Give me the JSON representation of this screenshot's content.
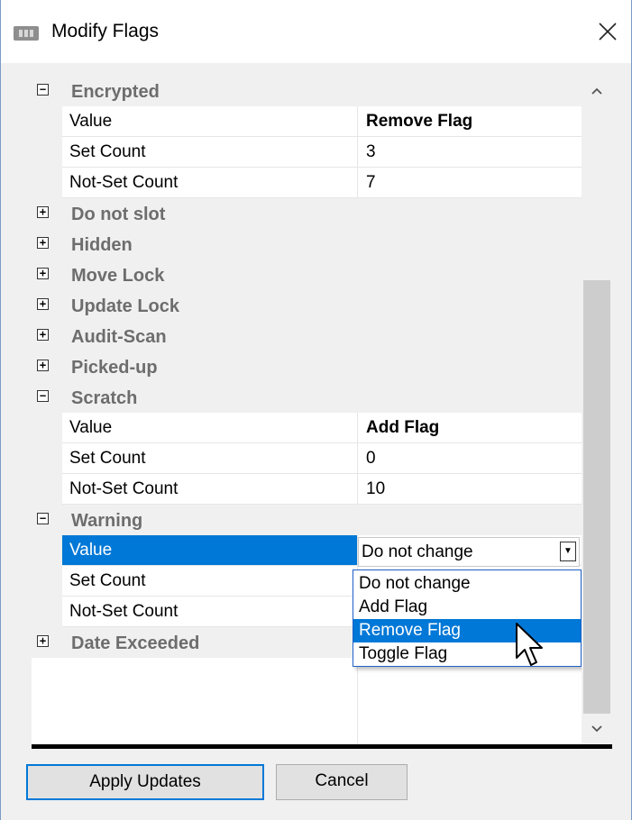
{
  "window": {
    "title": "Modify Flags",
    "icon": "app-icon",
    "close": "close-icon"
  },
  "grid": {
    "rows": [
      {
        "type": "category",
        "expander": "⊟",
        "label": "Encrypted",
        "expanded": true
      },
      {
        "type": "property",
        "name": "Value",
        "value": "Remove Flag",
        "bold": true
      },
      {
        "type": "property",
        "name": "Set Count",
        "value": "3"
      },
      {
        "type": "property",
        "name": "Not-Set Count",
        "value": "7"
      },
      {
        "type": "category",
        "expander": "⊞",
        "label": "Do not slot",
        "expanded": false
      },
      {
        "type": "category",
        "expander": "⊞",
        "label": "Hidden",
        "expanded": false
      },
      {
        "type": "category",
        "expander": "⊞",
        "label": "Move Lock",
        "expanded": false
      },
      {
        "type": "category",
        "expander": "⊞",
        "label": "Update Lock",
        "expanded": false
      },
      {
        "type": "category",
        "expander": "⊞",
        "label": "Audit-Scan",
        "expanded": false
      },
      {
        "type": "category",
        "expander": "⊞",
        "label": "Picked-up",
        "expanded": false
      },
      {
        "type": "category",
        "expander": "⊟",
        "label": "Scratch",
        "expanded": true
      },
      {
        "type": "property",
        "name": "Value",
        "value": "Add Flag",
        "bold": true
      },
      {
        "type": "property",
        "name": "Set Count",
        "value": "0"
      },
      {
        "type": "property",
        "name": "Not-Set Count",
        "value": "10"
      },
      {
        "type": "category",
        "expander": "⊟",
        "label": "Warning",
        "expanded": true
      },
      {
        "type": "property",
        "name": "Value",
        "value": "",
        "selected": true
      },
      {
        "type": "property",
        "name": "Set Count",
        "value": ""
      },
      {
        "type": "property",
        "name": "Not-Set Count",
        "value": ""
      },
      {
        "type": "category",
        "expander": "⊞",
        "label": "Date Exceeded",
        "expanded": false
      }
    ]
  },
  "combo": {
    "value": "Do not change",
    "options": [
      "Do not change",
      "Add Flag",
      "Remove Flag",
      "Toggle Flag"
    ],
    "highlighted_index": 2
  },
  "scrollbar": {
    "up": "chevron-up-icon",
    "down": "chevron-down-icon"
  },
  "buttons": {
    "apply_label": "Apply Updates",
    "cancel_label": "Cancel"
  },
  "colors": {
    "selection": "#0078d7",
    "category_text": "#6d6d6d"
  }
}
